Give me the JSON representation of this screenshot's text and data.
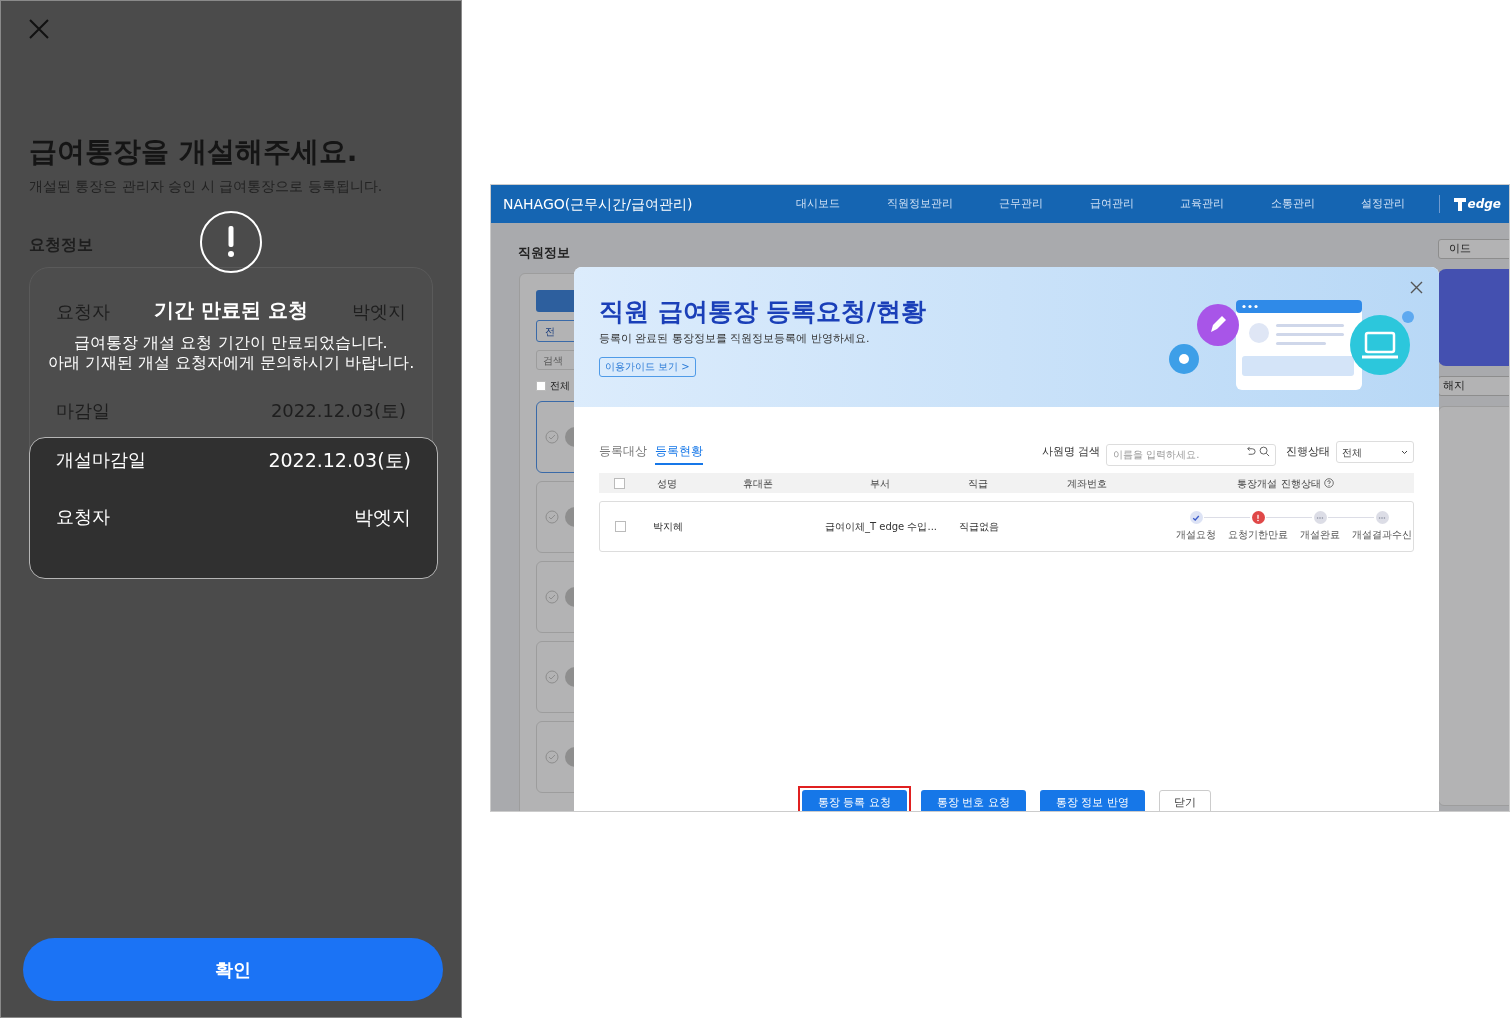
{
  "left": {
    "title": "급여통장을 개설해주세요.",
    "subtitle": "개설된 통장은 관리자 승인 시 급여통장으로 등록됩니다.",
    "section": "요청정보",
    "request_rows": [
      {
        "label": "요청자",
        "value": "박엣지"
      },
      {
        "label": "마감일",
        "value": "2022.12.03(토)"
      }
    ],
    "alert": {
      "title": "기간 만료된 요청",
      "message_lines": [
        "급여통장 개설 요청 기간이 만료되었습니다.",
        "아래 기재된 개설 요청자에게 문의하시기 바랍니다."
      ],
      "details": [
        {
          "label": "개설마감일",
          "value": "2022.12.03(토)"
        },
        {
          "label": "요청자",
          "value": "박엣지"
        }
      ]
    },
    "confirm_button": "확인"
  },
  "right": {
    "app_title": "NAHAGO(근무시간/급여관리)",
    "nav": [
      "대시보드",
      "직원정보관리",
      "근무관리",
      "급여관리",
      "교육관리",
      "소통관리",
      "설정관리"
    ],
    "logo_text": "edge",
    "background": {
      "page_title": "직원정보",
      "tab_button": "전",
      "search_placeholder": "검색",
      "select_all": {
        "label": "전체",
        "checked": false
      },
      "guide_button": "이드",
      "cancel_button": "해지"
    },
    "modal": {
      "title": "직원 급여통장 등록요청/현황",
      "subtitle": "등록이 완료된 통장정보를 직원정보등록에 반영하세요.",
      "guide_button": "이용가이드 보기 >",
      "tabs": [
        {
          "label": "등록대상",
          "selected": false
        },
        {
          "label": "등록현황",
          "selected": true
        }
      ],
      "search_label": "사원명 검색",
      "search_placeholder": "이름을 입력하세요.",
      "status_label": "진행상태",
      "status_select": "전체",
      "header_checked": false,
      "columns": [
        "성명",
        "휴대폰",
        "부서",
        "직급",
        "계좌번호",
        "통장개설 진행상태"
      ],
      "rows": [
        {
          "checked": false,
          "name": "박지혜",
          "department": "급여이체_T edge 수입...",
          "position": "직급없음",
          "steps": [
            {
              "label": "개설요청",
              "kind": "done"
            },
            {
              "label": "요청기한만료",
              "kind": "error"
            },
            {
              "label": "개설완료",
              "kind": "pending"
            },
            {
              "label": "개설결과수신",
              "kind": "pending"
            }
          ]
        }
      ],
      "buttons": [
        {
          "label": "통장 등록 요청",
          "kind": "primary",
          "highlighted": true
        },
        {
          "label": "통장 번호 요청",
          "kind": "primary",
          "highlighted": false
        },
        {
          "label": "통장 정보 반영",
          "kind": "primary",
          "highlighted": false
        },
        {
          "label": "닫기",
          "kind": "secondary",
          "highlighted": false
        }
      ]
    }
  }
}
